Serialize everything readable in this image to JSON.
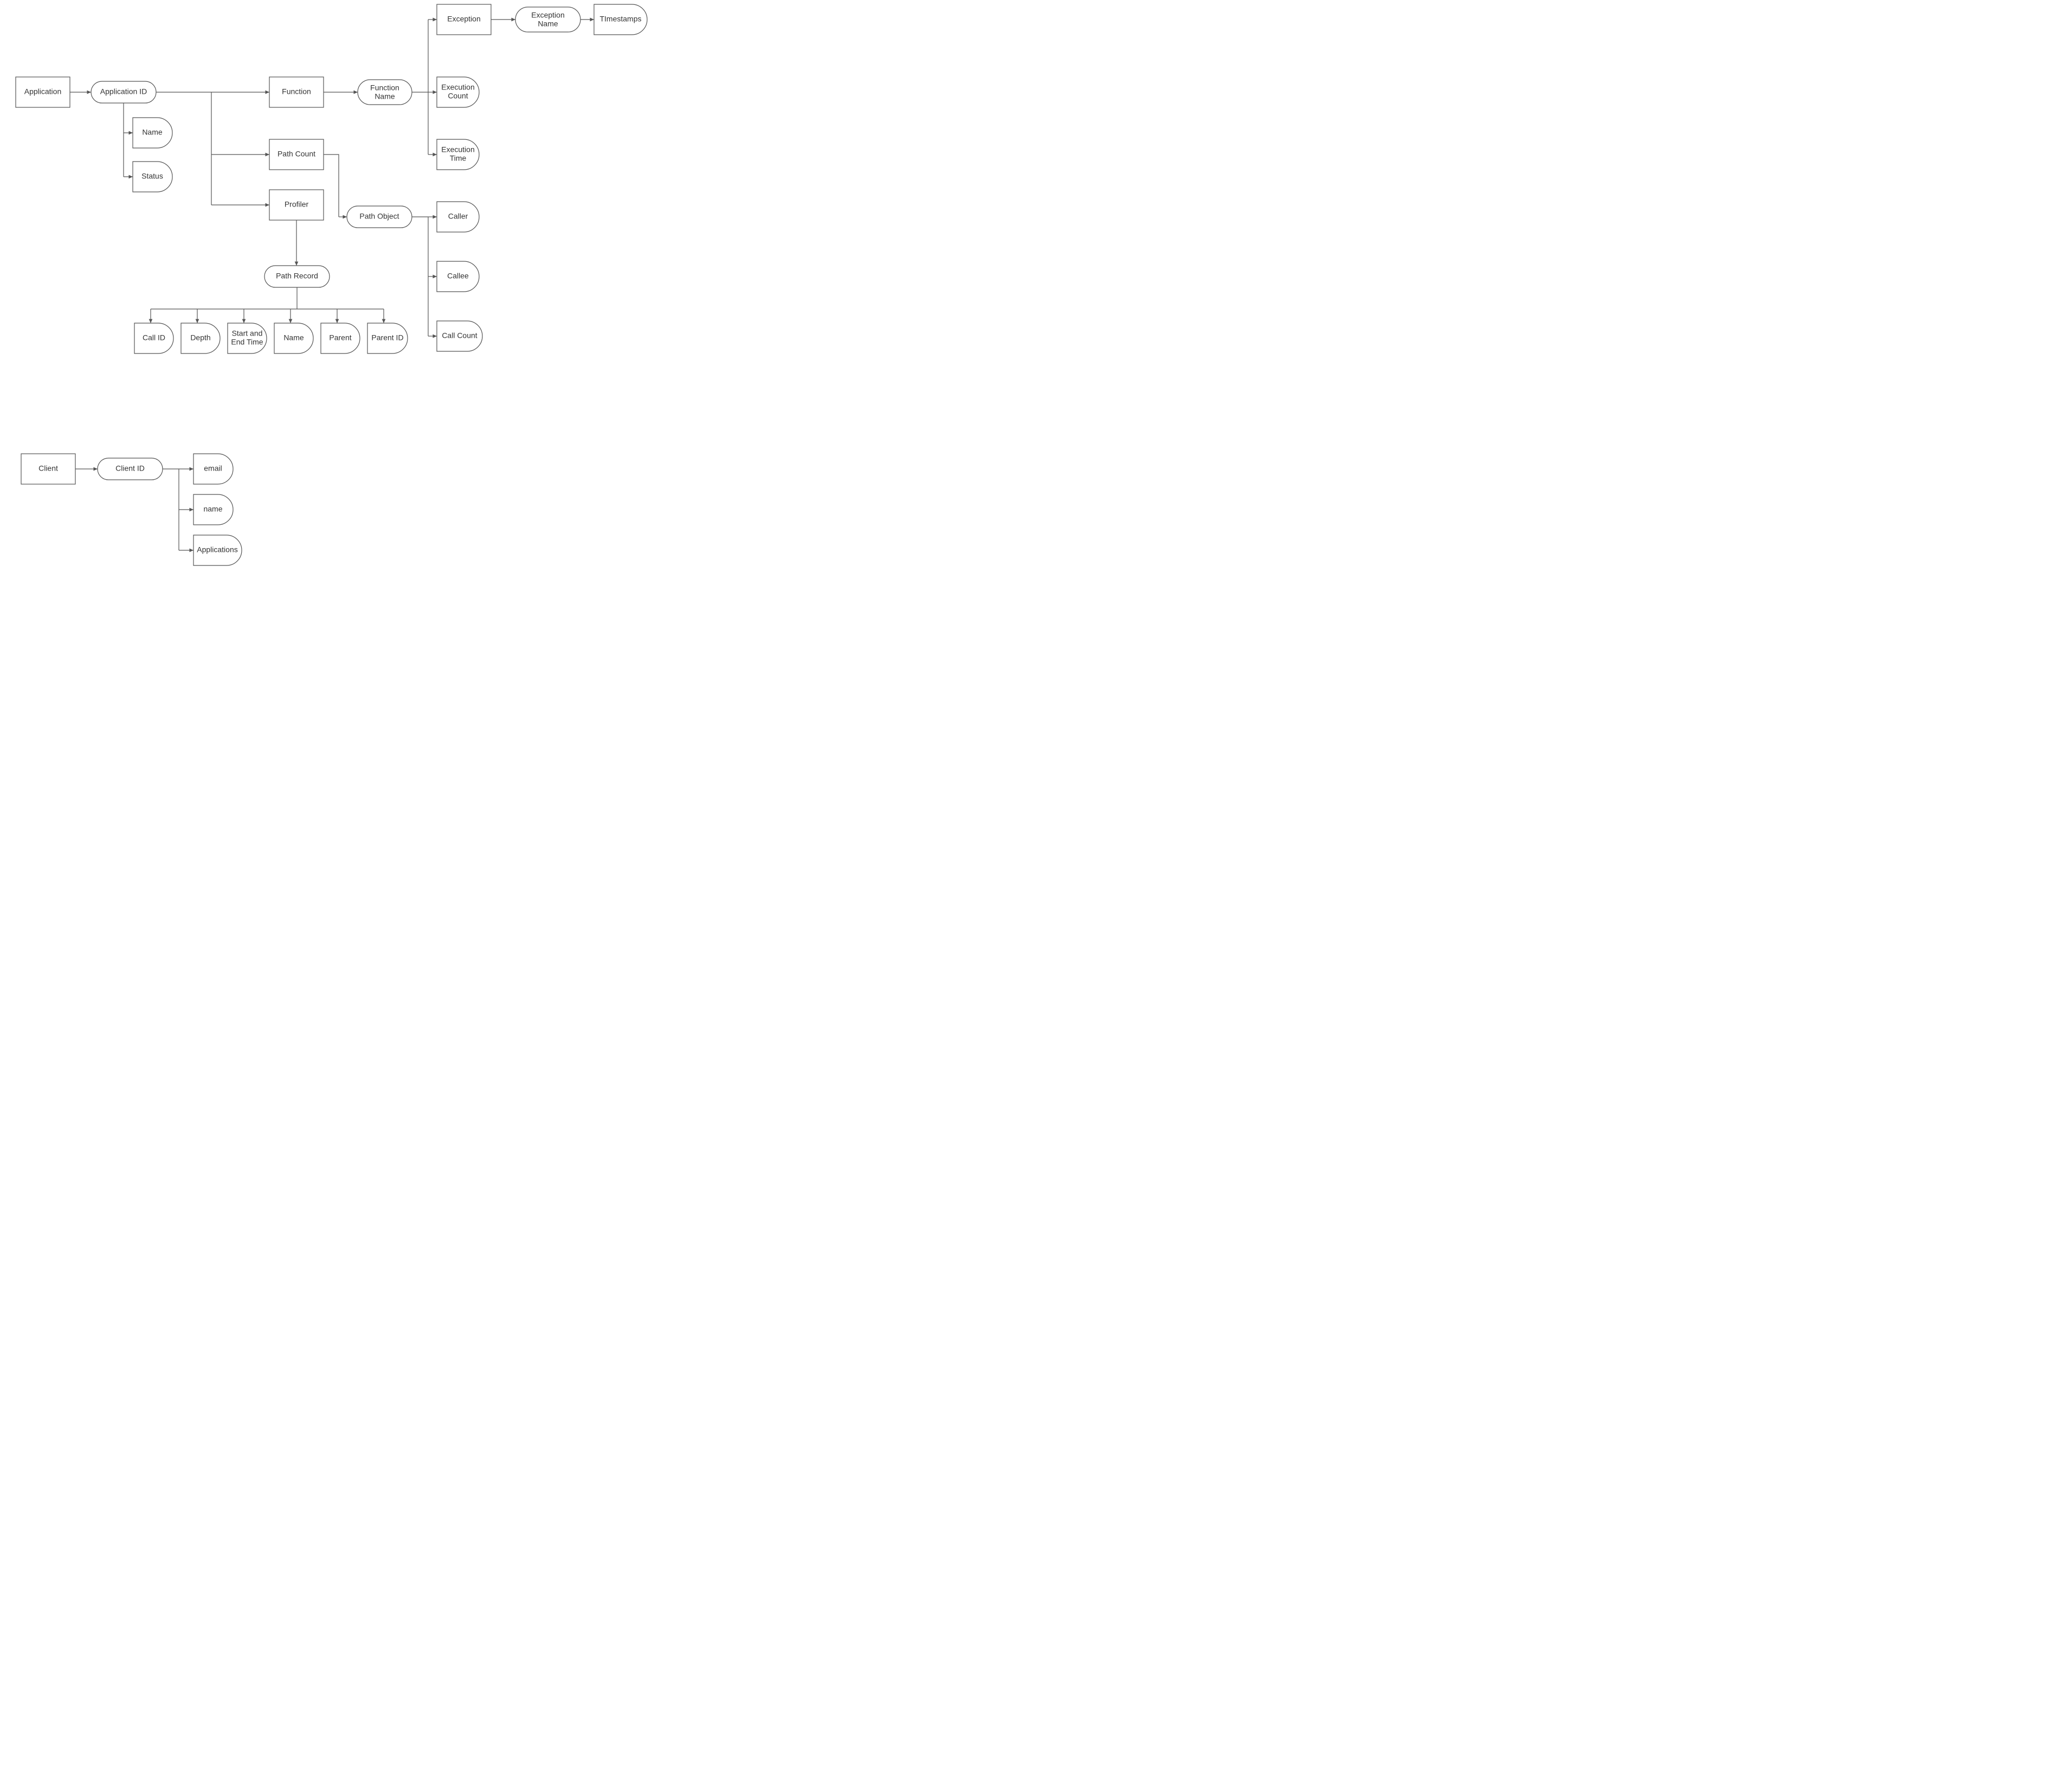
{
  "nodes": {
    "application": "Application",
    "applicationId": "Application ID",
    "name": "Name",
    "status": "Status",
    "function": "Function",
    "functionName1": "Function",
    "functionName2": "Name",
    "pathCount": "Path Count",
    "profiler": "Profiler",
    "pathRecord": "Path Record",
    "pathObject": "Path Object",
    "exception": "Exception",
    "exceptionName1": "Exception",
    "exceptionName2": "Name",
    "timestamps": "TImestamps",
    "executionCount1": "Execution",
    "executionCount2": "Count",
    "executionTime1": "Execution",
    "executionTime2": "Time",
    "caller": "Caller",
    "callee": "Callee",
    "callCount": "Call Count",
    "callId": "Call ID",
    "depth": "Depth",
    "startEnd1": "Start and",
    "startEnd2": "End Time",
    "prName": "Name",
    "parent": "Parent",
    "parentId": "Parent ID",
    "client": "Client",
    "clientId": "Client ID",
    "email": "email",
    "cname": "name",
    "applications": "Applications"
  }
}
